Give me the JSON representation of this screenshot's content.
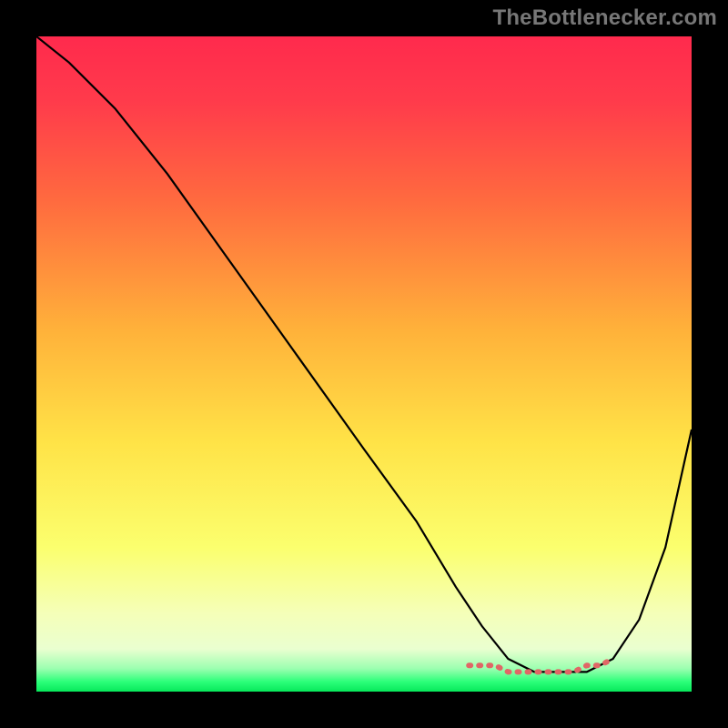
{
  "watermark": {
    "text": "TheBottlenecker.com"
  },
  "chart_data": {
    "type": "line",
    "title": "",
    "xlabel": "",
    "ylabel": "",
    "xlim": [
      0,
      100
    ],
    "ylim": [
      0,
      100
    ],
    "grid": false,
    "legend": false,
    "background_gradient_stops": [
      {
        "offset": 0,
        "color": "#ff2a4d"
      },
      {
        "offset": 0.1,
        "color": "#ff3b4b"
      },
      {
        "offset": 0.25,
        "color": "#ff6a3f"
      },
      {
        "offset": 0.45,
        "color": "#ffb23a"
      },
      {
        "offset": 0.62,
        "color": "#ffe347"
      },
      {
        "offset": 0.78,
        "color": "#fbff6e"
      },
      {
        "offset": 0.88,
        "color": "#f5ffb8"
      },
      {
        "offset": 0.935,
        "color": "#eaffd0"
      },
      {
        "offset": 0.965,
        "color": "#9bffb0"
      },
      {
        "offset": 0.985,
        "color": "#2bff79"
      },
      {
        "offset": 1.0,
        "color": "#07e85b"
      }
    ],
    "series": [
      {
        "name": "bottleneck-curve",
        "color": "#000000",
        "stroke_width": 2.2,
        "x": [
          0,
          5,
          12,
          20,
          30,
          40,
          50,
          58,
          64,
          68,
          72,
          76,
          80,
          84,
          88,
          92,
          96,
          100
        ],
        "values": [
          100,
          96,
          89,
          79,
          65,
          51,
          37,
          26,
          16,
          10,
          5,
          3,
          3,
          3,
          5,
          11,
          22,
          40
        ]
      },
      {
        "name": "flat-valley-marker",
        "color": "#e06666",
        "stroke_width": 6,
        "dash": "2 9",
        "x": [
          66,
          68,
          70,
          72,
          74,
          76,
          78,
          80,
          82,
          84,
          86,
          88
        ],
        "values": [
          4,
          4,
          4,
          3,
          3,
          3,
          3,
          3,
          3,
          4,
          4,
          5
        ]
      }
    ]
  }
}
